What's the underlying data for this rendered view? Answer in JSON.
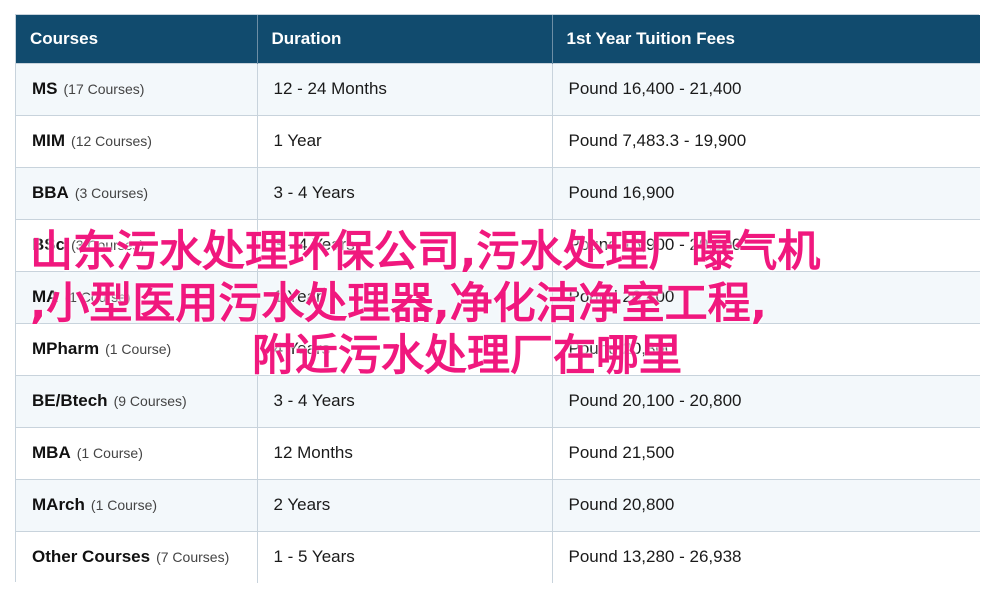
{
  "table": {
    "headers": [
      "Courses",
      "Duration",
      "1st Year Tuition Fees"
    ],
    "rows": [
      {
        "course": "MS",
        "count": "(17 Courses)",
        "duration": "12 - 24 Months",
        "fees": "Pound 16,400 - 21,400"
      },
      {
        "course": "MIM",
        "count": "(12 Courses)",
        "duration": "1 Year",
        "fees": "Pound 7,483.3 - 19,900"
      },
      {
        "course": "BBA",
        "count": "(3 Courses)",
        "duration": "3 - 4 Years",
        "fees": "Pound 16,900"
      },
      {
        "course": "BSc",
        "count": "(3 Courses)",
        "duration": "3 - 4 Years",
        "fees": "Pound 16,900 - 20,800"
      },
      {
        "course": "MA",
        "count": "(1 Course)",
        "duration": "1 Year",
        "fees": "Pound 20,800"
      },
      {
        "course": "MPharm",
        "count": "(1 Course)",
        "duration": "4 Years",
        "fees": "Pound 20,800"
      },
      {
        "course": "BE/Btech",
        "count": "(9 Courses)",
        "duration": "3 - 4 Years",
        "fees": "Pound 20,100 - 20,800"
      },
      {
        "course": "MBA",
        "count": "(1 Course)",
        "duration": "12 Months",
        "fees": "Pound 21,500"
      },
      {
        "course": "MArch",
        "count": "(1 Course)",
        "duration": "2 Years",
        "fees": "Pound 20,800"
      },
      {
        "course": "Other Courses",
        "count": "(7 Courses)",
        "duration": "1 - 5 Years",
        "fees": "Pound 13,280 - 26,938"
      }
    ]
  },
  "overlay_text": {
    "line1": "山东污水处理环保公司,污水处理厂曝气机",
    "line2": ",小型医用污水处理器,净化洁净室工程,",
    "line3": "附近污水处理厂在哪里"
  },
  "colors": {
    "header_bg": "#114b6e",
    "row_alt_bg": "#f3f8fb",
    "overlay_text": "#f0187e"
  }
}
